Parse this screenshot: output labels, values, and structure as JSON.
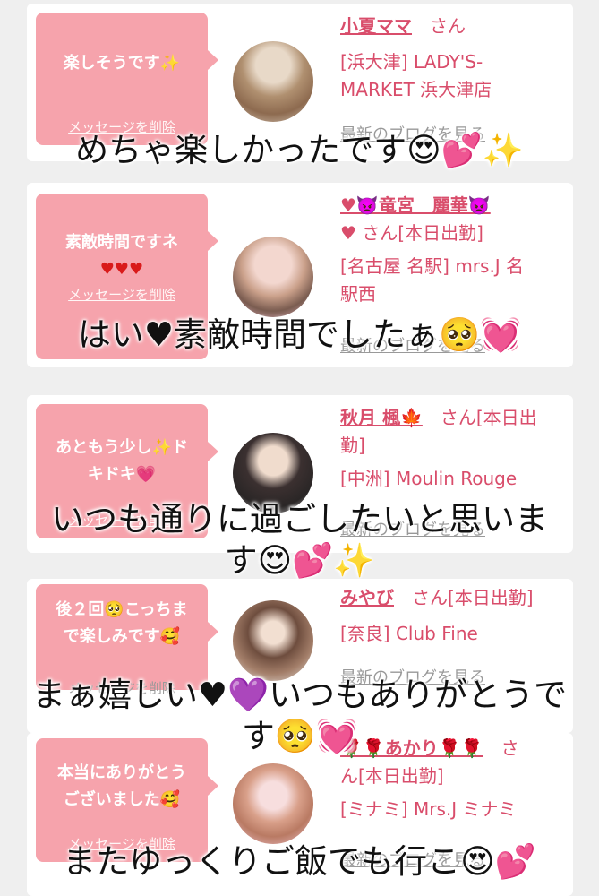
{
  "cards": [
    {
      "message": "楽しそうです✨",
      "delete_label": "メッセージを削除",
      "name": "小夏ママ",
      "honorific": "さん",
      "shop_line1": "[浜大津] LADY'S-",
      "shop_line2": "MARKET 浜大津店",
      "blog_label": "最新のブログを見る",
      "caption": "めちゃ楽しかったです😍💕✨"
    },
    {
      "message": "素敵時間ですネ",
      "message2": "♥♥♥",
      "delete_label": "メッセージを削除",
      "name": "♥👿竜宮　麗華👿",
      "honorific_line": "♥ さん[本日出勤]",
      "shop_line1": "[名古屋 名駅] mrs.J 名",
      "shop_line2": "駅西",
      "blog_label": "最新のブログを見る",
      "caption": "はい♥素敵時間でしたぁ🥺💓"
    },
    {
      "message": "あともう少し✨ド",
      "message2": "キドキ💗",
      "delete_label": "メッセージを削除",
      "name": "秋月 楓🍁",
      "honorific": "さん[本日出",
      "honorific2": "勤]",
      "shop_line1": "[中洲] Moulin Rouge",
      "blog_label": "最新のブログを見る",
      "caption": "いつも通りに過ごしたいと思いま",
      "caption2": "す😍💕✨"
    },
    {
      "message": "後２回🥺こっちま",
      "message2": "で楽しみです🥰",
      "delete_label": "メッセージを削除",
      "name": "みやび",
      "honorific": "さん[本日出勤]",
      "shop_line1": "[奈良] Club Fine",
      "blog_label": "最新のブログを見る",
      "caption": "まぁ嬉しい♥💜いつもありがとうで",
      "caption2": "す🥺💓"
    },
    {
      "message": "本当にありがとう",
      "message2": "ございました🥰",
      "delete_label": "メッセージを削除",
      "name": "🌹🌹あかり🌹🌹",
      "honorific": "さ",
      "honorific2": "ん[本日出勤]",
      "shop_line1": "[ミナミ] Mrs.J ミナミ",
      "blog_label": "最新のブログを見る",
      "caption": "またゆっくりご飯でも行こ😍💕"
    }
  ],
  "colors": {
    "accent": "#d94d6b",
    "bubble": "#f6a3ac",
    "background": "#efefef"
  }
}
